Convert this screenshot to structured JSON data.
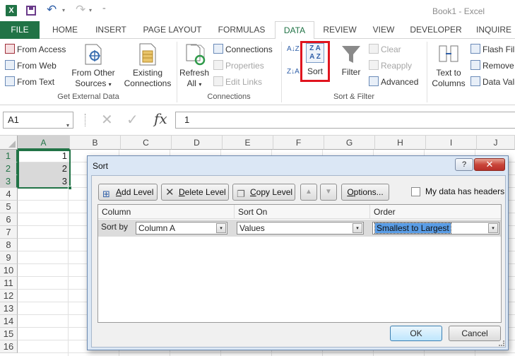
{
  "window": {
    "title": "Book1 - Excel"
  },
  "quick_access": {
    "logo": "X",
    "undo_glyph": "↶",
    "redo_glyph": "↷",
    "dropdown_glyph": "▾",
    "more_glyph": "⁼"
  },
  "tabs": [
    {
      "label": "FILE"
    },
    {
      "label": "HOME"
    },
    {
      "label": "INSERT"
    },
    {
      "label": "PAGE LAYOUT"
    },
    {
      "label": "FORMULAS"
    },
    {
      "label": "DATA"
    },
    {
      "label": "REVIEW"
    },
    {
      "label": "VIEW"
    },
    {
      "label": "DEVELOPER"
    },
    {
      "label": "INQUIRE"
    }
  ],
  "ribbon": {
    "get_external": {
      "from_access": "From Access",
      "from_web": "From Web",
      "from_text": "From Text",
      "from_other_1": "From Other",
      "from_other_2": "Sources",
      "dropdown": "▾",
      "existing_1": "Existing",
      "existing_2": "Connections",
      "label": "Get External Data"
    },
    "connections": {
      "refresh_1": "Refresh",
      "refresh_2": "All",
      "dropdown": "▾",
      "connections": "Connections",
      "properties": "Properties",
      "edit_links": "Edit Links",
      "label": "Connections"
    },
    "sort_filter": {
      "sort_az": "A↓Z",
      "sort_za": "Z↓A",
      "sort_glyph_top": "Z A",
      "sort_glyph_bottom": "A Z",
      "sort": "Sort",
      "filter": "Filter",
      "clear": "Clear",
      "reapply": "Reapply",
      "advanced": "Advanced",
      "label": "Sort & Filter"
    },
    "data_tools": {
      "text_to_1": "Text to",
      "text_to_2": "Columns",
      "flash_fill": "Flash Fill",
      "remove": "Remove",
      "data_vali": "Data Vali"
    }
  },
  "formula_bar": {
    "name_box": "A1",
    "dropdown": "▾",
    "cancel_glyph": "✕",
    "enter_glyph": "✓",
    "fx": "fx",
    "value": "1"
  },
  "grid": {
    "columns": [
      "A",
      "B",
      "C",
      "D",
      "E",
      "F",
      "G",
      "H",
      "I",
      "J"
    ],
    "rows": [
      "1",
      "2",
      "3",
      "4",
      "5",
      "6",
      "7",
      "8",
      "9",
      "10",
      "11",
      "12",
      "13",
      "14",
      "15",
      "16"
    ],
    "cells": [
      "1",
      "2",
      "3"
    ]
  },
  "dialog": {
    "title": "Sort",
    "help": "?",
    "close": "✕",
    "add_level_mn": "A",
    "add_level_rest": "dd Level",
    "delete_level_mn": "D",
    "delete_level_rest": "elete Level",
    "copy_level_mn": "C",
    "copy_level_rest": "opy Level",
    "move_up": "▲",
    "move_down": "▼",
    "options_mn": "O",
    "options_rest": "ptions...",
    "headers_label": "My data has headers",
    "headers_checked": false,
    "col_header": "Column",
    "sort_on_header": "Sort On",
    "order_header": "Order",
    "sort_by": "Sort by",
    "column_value": "Column A",
    "sort_on_value": "Values",
    "order_value": "Smallest to Largest",
    "dropdown": "▾",
    "ok": "OK",
    "cancel": "Cancel"
  }
}
